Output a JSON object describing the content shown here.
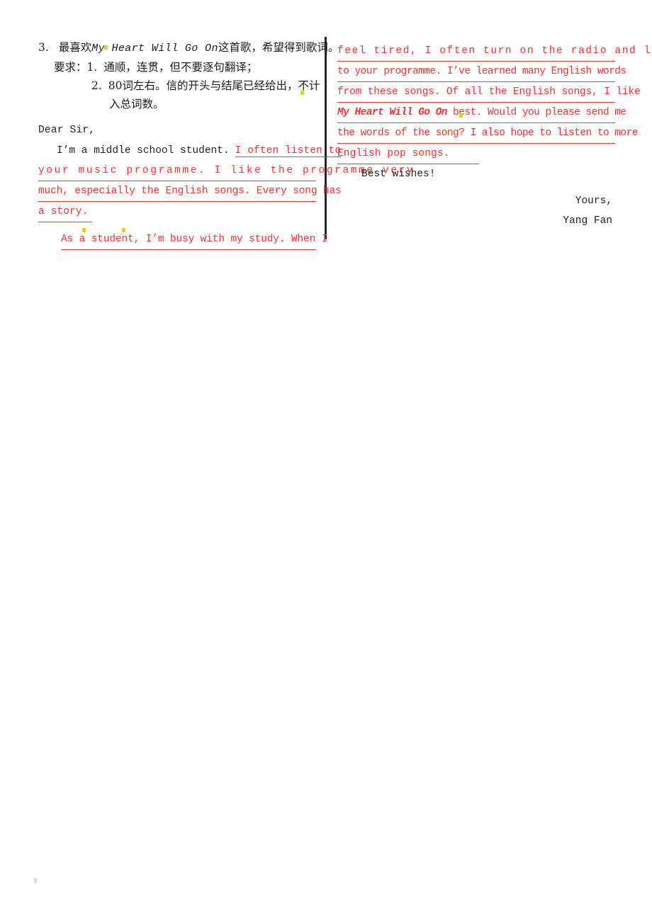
{
  "document": {
    "divider_color": "#262626",
    "red_color": "#ff2f2f",
    "black_color": "#1f1f1f"
  },
  "prompt": {
    "item_number": "3.",
    "line1_before": "最喜欢",
    "line1_song": "My  Heart  Will  Go  On",
    "line1_after": "这首歌，希望得到歌词。",
    "requirements_label": "要求：",
    "req1_number": "1.",
    "req1_text": "通顺，连贯，但不要逐句翻译；",
    "req2_number": "2.",
    "req2_text": "80词左右。信的开头与结尾已经给出，不计",
    "req2_cont": "入总词数。"
  },
  "letter": {
    "salutation": "Dear Sir,",
    "para1_black": "I’m a middle school student.",
    "para1_red_tail": "I often listen to",
    "para1_red_lines": [
      "your  music  programme.  I  like  the  programme  very",
      "much, especially the English songs. Every song has",
      "a story. "
    ],
    "para2_red_lines": [
      "As a student, I’m busy with my study. When I",
      "feel  tired,  I  often  turn  on  the  radio  and  listen",
      "to your programme. I’ve learned many English words",
      "from these songs. Of all the English songs, I like"
    ],
    "para2_line5_song": "My Heart Will Go On",
    "para2_line5_rest": " best. Would you please send me",
    "para2_line6": "the words of the song? I also hope to listen to more",
    "para2_line7": "English pop songs. ",
    "best_wishes": "Best wishes!",
    "yours": "Yours,",
    "signature": "Yang Fan"
  }
}
